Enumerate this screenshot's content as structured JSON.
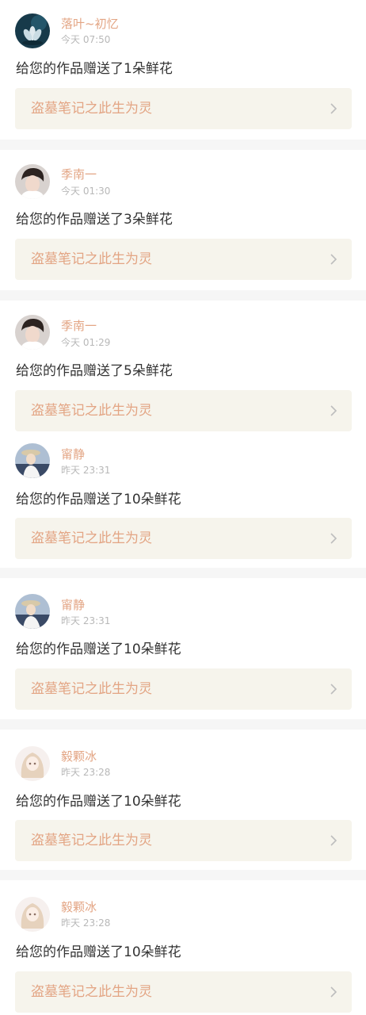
{
  "colors": {
    "accent": "#e3a584",
    "time": "#b8b8b8",
    "message": "#333333",
    "work_bg": "#f6f4ec",
    "separator": "#f6f6f6"
  },
  "notifications": [
    {
      "user": "落叶~初忆",
      "time": "今天 07:50",
      "message": "给您的作品赠送了1朵鲜花",
      "work_title": "盗墓笔记之此生为灵",
      "avatar": "lotus-avatar"
    },
    {
      "user": "季南一",
      "time": "今天 01:30",
      "message": "给您的作品赠送了3朵鲜花",
      "work_title": "盗墓笔记之此生为灵",
      "avatar": "boy-avatar"
    },
    {
      "user": "季南一",
      "time": "今天 01:29",
      "message": "给您的作品赠送了5朵鲜花",
      "work_title": "盗墓笔记之此生为灵",
      "avatar": "boy-avatar"
    },
    {
      "user": "甯静",
      "time": "昨天 23:31",
      "message": "给您的作品赠送了10朵鲜花",
      "work_title": "盗墓笔记之此生为灵",
      "avatar": "girl-hat-avatar"
    },
    {
      "user": "甯静",
      "time": "昨天 23:31",
      "message": "给您的作品赠送了10朵鲜花",
      "work_title": "盗墓笔记之此生为灵",
      "avatar": "girl-hat-avatar"
    },
    {
      "user": "毅颗冰",
      "time": "昨天 23:28",
      "message": "给您的作品赠送了10朵鲜花",
      "work_title": "盗墓笔记之此生为灵",
      "avatar": "anime-girl-avatar"
    },
    {
      "user": "毅颗冰",
      "time": "昨天 23:28",
      "message": "给您的作品赠送了10朵鲜花",
      "work_title": "盗墓笔记之此生为灵",
      "avatar": "anime-girl-avatar"
    }
  ]
}
